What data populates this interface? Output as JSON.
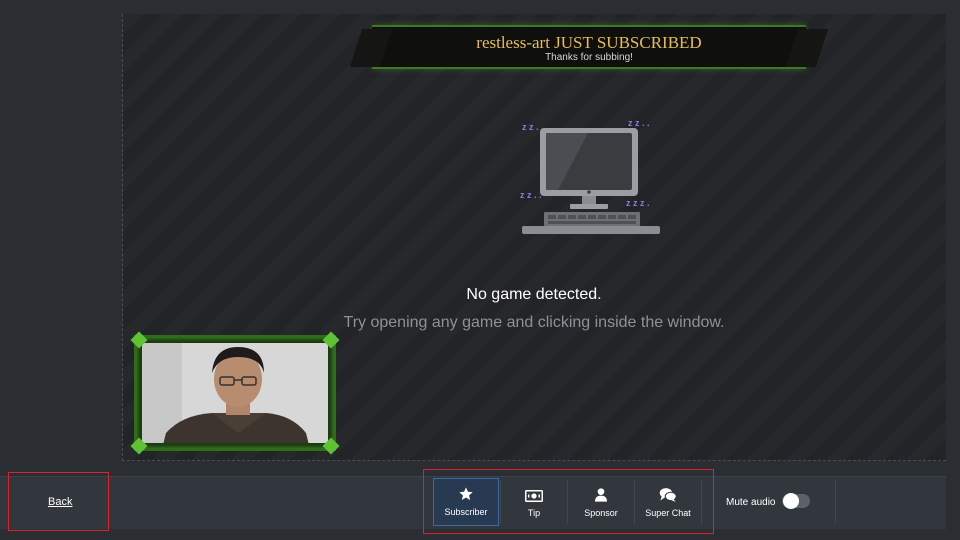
{
  "banner": {
    "title": "restless-art JUST SUBSCRIBED",
    "subtitle": "Thanks for subbing!"
  },
  "status": {
    "heading": "No game detected.",
    "hint": "Try opening any game and clicking inside the window.",
    "icon": "sleeping-monitor-icon"
  },
  "webcam": {
    "frame_color": "#3c8a22"
  },
  "bottom_bar": {
    "back_label": "Back",
    "tabs": [
      {
        "label": "Subscriber",
        "icon": "star-icon",
        "active": true
      },
      {
        "label": "Tip",
        "icon": "money-icon",
        "active": false
      },
      {
        "label": "Sponsor",
        "icon": "person-icon",
        "active": false
      },
      {
        "label": "Super Chat",
        "icon": "chat-icon",
        "active": false
      }
    ],
    "mute_label": "Mute audio",
    "mute_on": false
  },
  "colors": {
    "banner_gold": "#e6be57",
    "highlight_red": "#d8242f",
    "active_tab": "#283a52"
  }
}
